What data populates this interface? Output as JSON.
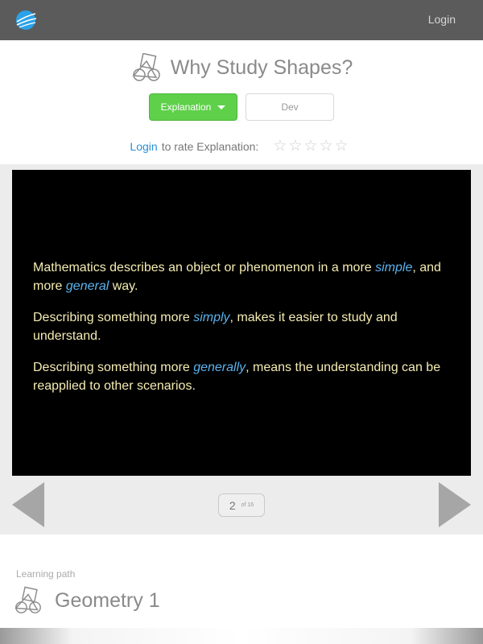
{
  "topbar": {
    "logo_icon": "globe-logo-icon",
    "login_label": "Login"
  },
  "header": {
    "title_icon": "geometric-shapes-icon",
    "title": "Why Study Shapes?",
    "explanation_button": "Explanation",
    "dev_button": "Dev",
    "rate": {
      "login_link": "Login",
      "text": "to rate Explanation:",
      "stars": [
        "☆",
        "☆",
        "☆",
        "☆",
        "☆"
      ]
    }
  },
  "slide": {
    "paragraphs": [
      {
        "before": "Mathematics describes an object or phenomenon in a more ",
        "em1": "simple",
        "middle": ", and more ",
        "em2": "general",
        "after": " way."
      },
      {
        "before": "Describing something more ",
        "em1": "simply",
        "after": ", makes it easier to study and understand."
      },
      {
        "before": "Describing something more ",
        "em1": "generally",
        "after": ", means the understanding can be reapplied to other scenarios."
      }
    ],
    "text_color": "#f5ecb2",
    "highlight_color": "#5bb3ee"
  },
  "pager": {
    "current": "2",
    "of_total": "of 16"
  },
  "learning_path": {
    "label": "Learning path",
    "icon": "geometric-shapes-icon",
    "title": "Geometry 1"
  },
  "colors": {
    "accent_green": "#5ed04a",
    "link_blue": "#2b8fd6",
    "topbar": "#5b5b5b"
  }
}
